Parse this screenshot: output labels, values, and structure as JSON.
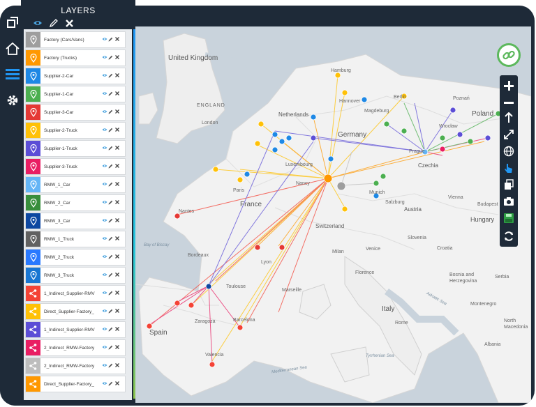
{
  "layers_panel": {
    "title": "LAYERS",
    "items": [
      {
        "label": "Factory (Cars/Vans)",
        "color": "#9e9e9e",
        "icon": "location-pin-icon"
      },
      {
        "label": "Factory (Trucks)",
        "color": "#ff9800",
        "icon": "location-pin-icon"
      },
      {
        "label": "Supplier-2-Car",
        "color": "#1e88e5",
        "icon": "location-pin-icon"
      },
      {
        "label": "Supplier-1-Car",
        "color": "#4caf50",
        "icon": "location-pin-icon"
      },
      {
        "label": "Supplier-3-Car",
        "color": "#e53935",
        "icon": "location-pin-icon"
      },
      {
        "label": "Supplier-2-Truck",
        "color": "#ffc107",
        "icon": "location-pin-icon"
      },
      {
        "label": "Supplier-1-Truck",
        "color": "#5c4ed6",
        "icon": "location-pin-icon"
      },
      {
        "label": "Supplier-3-Truck",
        "color": "#e91e63",
        "icon": "location-pin-icon"
      },
      {
        "label": "RMW_1_Car",
        "color": "#64b5f6",
        "icon": "location-pin-icon"
      },
      {
        "label": "RMW_2_Car",
        "color": "#388e3c",
        "icon": "location-pin-icon"
      },
      {
        "label": "RMW_3_Car",
        "color": "#0d47a1",
        "icon": "location-pin-icon"
      },
      {
        "label": "RMW_1_Truck",
        "color": "#616161",
        "icon": "location-pin-icon"
      },
      {
        "label": "RMW_2_Truck",
        "color": "#2979ff",
        "icon": "location-pin-icon"
      },
      {
        "label": "RMW_3_Truck",
        "color": "#1976d2",
        "icon": "location-pin-icon"
      },
      {
        "label": "1_Indirect_Supplier-RMV",
        "color": "#f44336",
        "icon": "share-nodes-icon"
      },
      {
        "label": "Direct_Supplier-Factory_",
        "color": "#ffc107",
        "icon": "share-nodes-icon"
      },
      {
        "label": "1_Indirect_Supplier-RMV",
        "color": "#5c4ed6",
        "icon": "share-nodes-icon"
      },
      {
        "label": "2_Indirect_RMW-Factory",
        "color": "#e91e63",
        "icon": "share-nodes-icon"
      },
      {
        "label": "2_Indirect_RMW-Factory",
        "color": "#bdbdbd",
        "icon": "share-nodes-icon"
      },
      {
        "label": "Direct_Supplier-Factory_",
        "color": "#ff9800",
        "icon": "share-nodes-icon"
      }
    ]
  },
  "map_labels": {
    "united_kingdom": "United Kingdom",
    "england": "ENGLAND",
    "london": "London",
    "netherlands": "Netherlands",
    "germany": "Germany",
    "berlin": "Berlin",
    "hamburg": "Hamburg",
    "hannover": "Hannover",
    "magdeburg": "Magdeburg",
    "poznan": "Poznań",
    "poland": "Poland",
    "warsaw": "Wrocław",
    "czechia": "Czechia",
    "prague": "Prague",
    "luxembourg": "Luxembourg",
    "paris": "Paris",
    "nancy": "Nancy",
    "munich": "Munich",
    "salzburg": "Salzburg",
    "austria": "Austria",
    "vienna": "Vienna",
    "france": "France",
    "switzerland": "Switzerland",
    "hungary": "Hungary",
    "budapest": "Budapest",
    "slovenia": "Slovenia",
    "croatia": "Croatia",
    "bosnia": "Bosnia and Herzegovina",
    "serbia": "Serbia",
    "italy": "Italy",
    "rome": "Rome",
    "montenegro": "Montenegro",
    "north_macedonia": "North Macedonia",
    "albania": "Albania",
    "spain": "Spain",
    "bay_of_biscay": "Bay of Biscay",
    "toulouse": "Toulouse",
    "nantes": "Nantes",
    "bordeaux": "Bordeaux",
    "zaragoza": "Zaragoza",
    "barcelona": "Barcelona",
    "valencia": "Valencia",
    "adriatic_sea": "Adriatic Sea",
    "mediterranean_sea": "Mediterranean Sea",
    "tyrrhenian_sea": "Tyrrhenian Sea",
    "lyon": "Lyon",
    "marseille": "Marseille",
    "milan": "Milan",
    "venice": "Venice",
    "florence": "Florence"
  },
  "map_tools": [
    "plus-icon",
    "minus-icon",
    "north-arrow-icon",
    "fullscreen-icon",
    "globe-icon",
    "pointer-icon",
    "layers-stack-icon",
    "camera-icon",
    "save-icon",
    "refresh-icon"
  ],
  "link_button": "link-icon"
}
